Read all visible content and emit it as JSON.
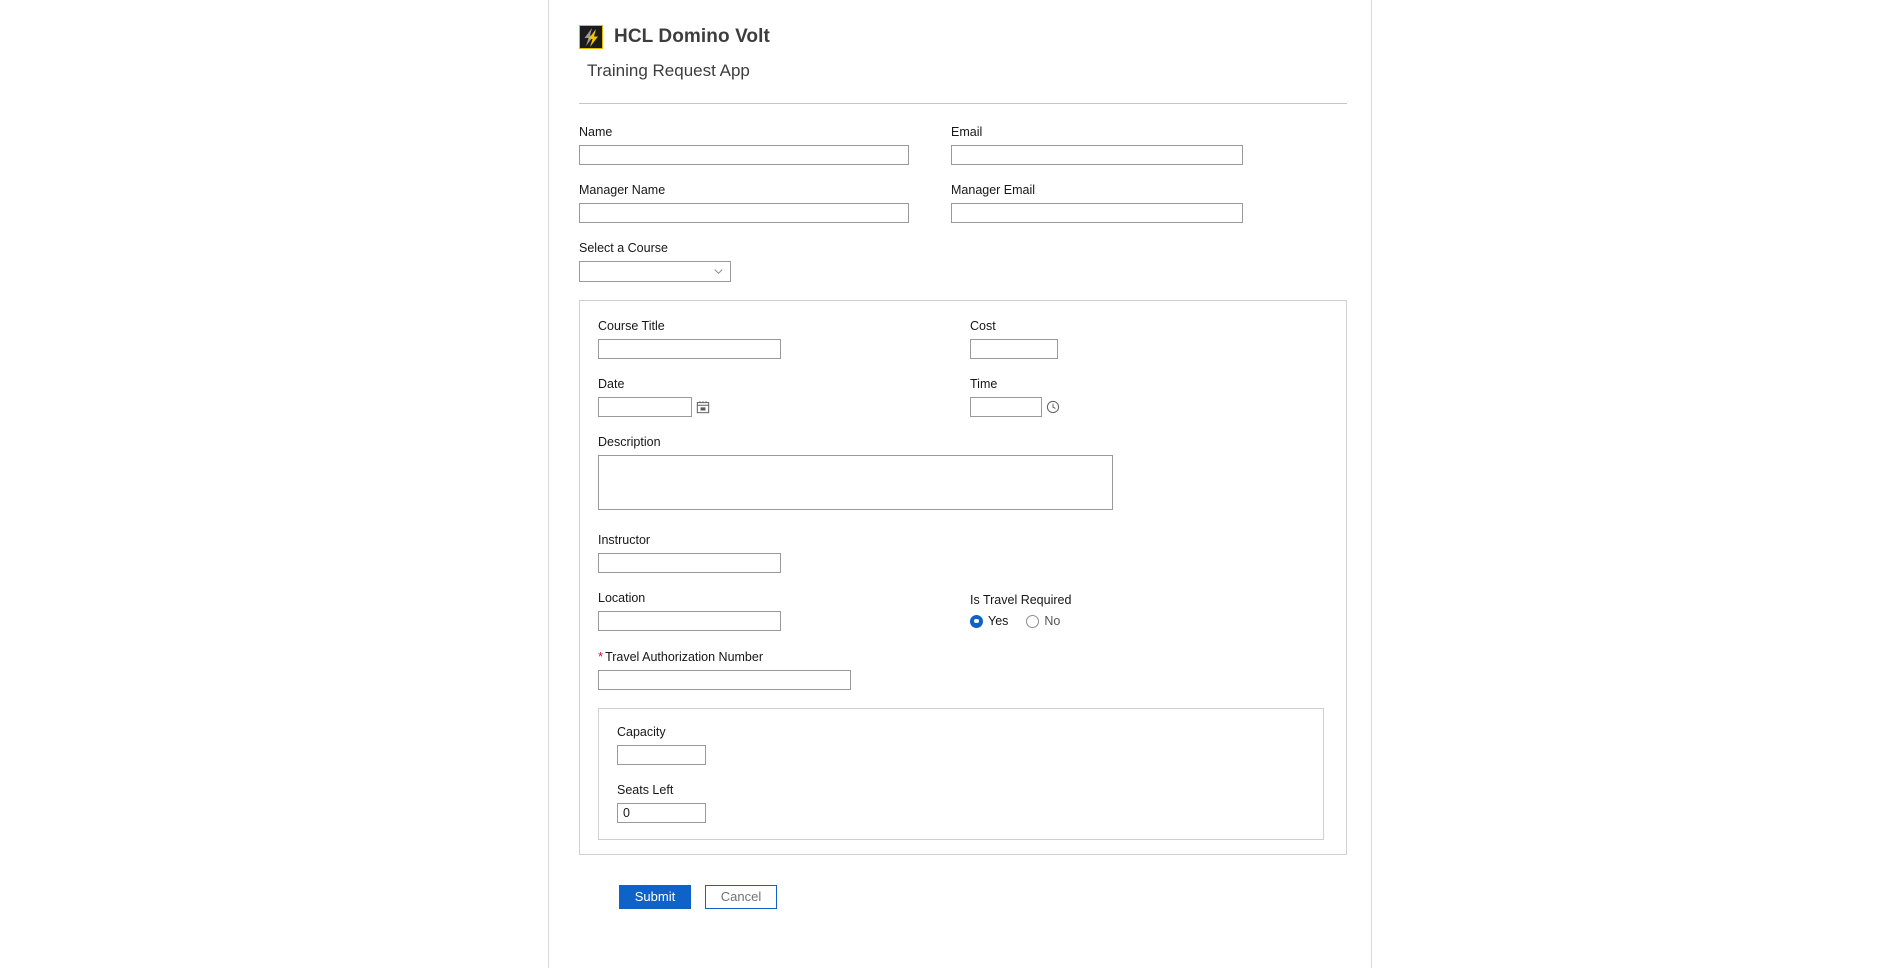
{
  "header": {
    "logo_icon": "volt-lightning-logo",
    "app_title": "HCL Domino Volt",
    "app_subtitle": "Training Request App"
  },
  "form": {
    "name": {
      "label": "Name",
      "value": ""
    },
    "email": {
      "label": "Email",
      "value": ""
    },
    "manager_name": {
      "label": "Manager Name",
      "value": ""
    },
    "manager_email": {
      "label": "Manager Email",
      "value": ""
    },
    "select_course": {
      "label": "Select a Course",
      "value": "",
      "chevron_icon": "chevron-down-icon"
    },
    "course_panel": {
      "course_title": {
        "label": "Course Title",
        "value": ""
      },
      "cost": {
        "label": "Cost",
        "value": ""
      },
      "date": {
        "label": "Date",
        "value": "",
        "icon": "calendar-icon"
      },
      "time": {
        "label": "Time",
        "value": "",
        "icon": "clock-icon"
      },
      "description": {
        "label": "Description",
        "value": ""
      },
      "instructor": {
        "label": "Instructor",
        "value": ""
      },
      "location": {
        "label": "Location",
        "value": ""
      },
      "is_travel_required": {
        "label": "Is Travel Required",
        "selected": "Yes",
        "options": [
          {
            "label": "Yes",
            "checked": true
          },
          {
            "label": "No",
            "checked": false
          }
        ]
      },
      "travel_authorization_number": {
        "label": "Travel Authorization Number",
        "required_marker": "*",
        "required": true,
        "value": ""
      },
      "capacity_panel": {
        "capacity": {
          "label": "Capacity",
          "value": ""
        },
        "seats_left": {
          "label": "Seats Left",
          "value": "0"
        }
      }
    }
  },
  "actions": {
    "submit_label": "Submit",
    "cancel_label": "Cancel"
  },
  "colors": {
    "accent_blue": "#0f62c8",
    "required_red": "#c8102e",
    "logo_yellow": "#e8b900",
    "border_gray": "#9a9a9a",
    "panel_border": "#d0d0d0"
  }
}
